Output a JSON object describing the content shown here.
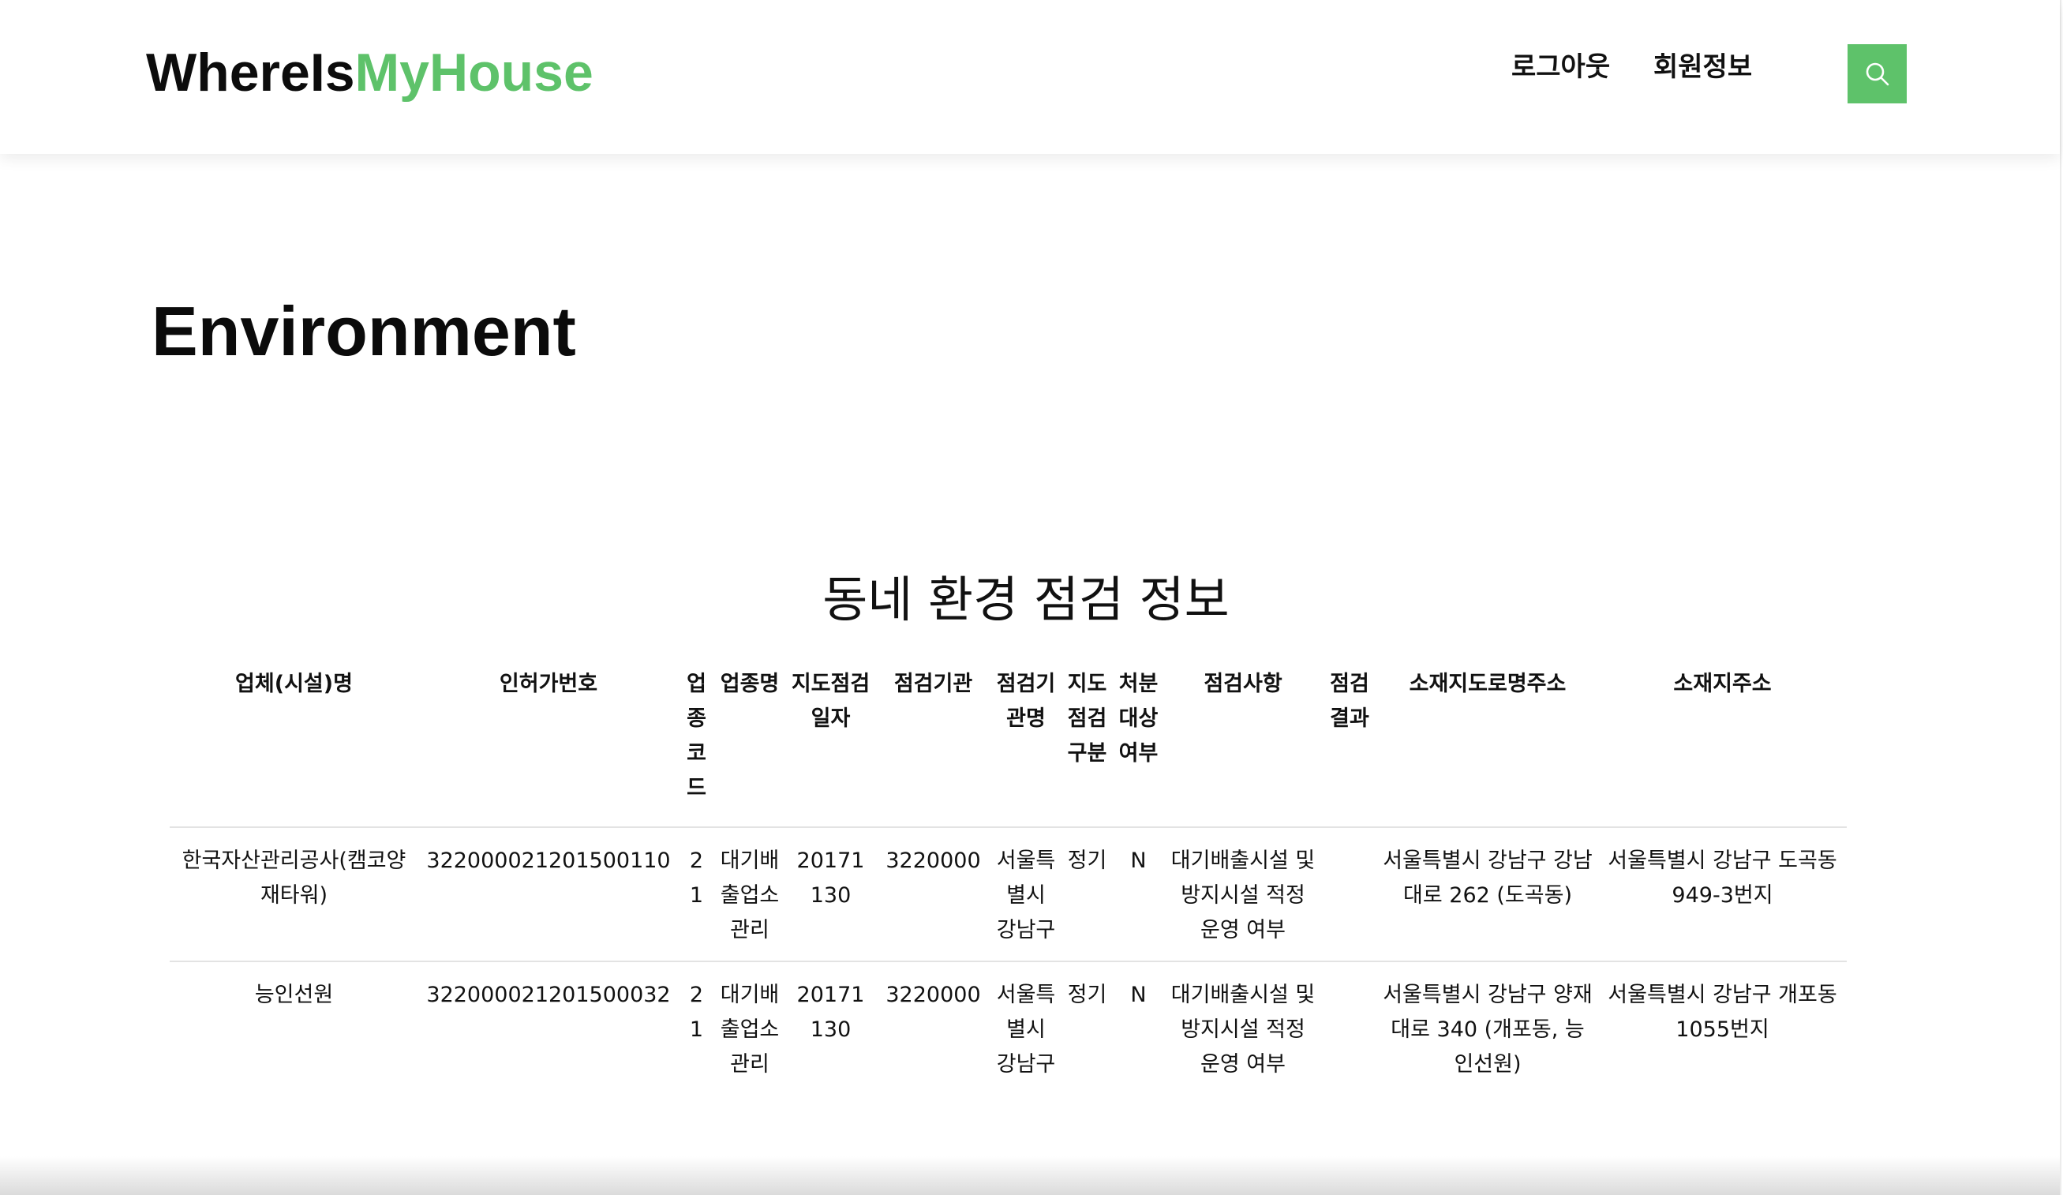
{
  "header": {
    "logo_part1": "WhereIs",
    "logo_part2": "MyHouse",
    "nav_logout": "로그아웃",
    "nav_member": "회원정보",
    "search_icon": "search-icon",
    "accent_color": "#5ec26a"
  },
  "page": {
    "title": "Environment"
  },
  "section": {
    "title": "동네 환경 점검 정보"
  },
  "table": {
    "headers": [
      "업체(시설)명",
      "인허가번호",
      "업종코드",
      "업종명",
      "지도점검일자",
      "점검기관",
      "점검기관명",
      "지도점검구분",
      "처분대상여부",
      "점검사항",
      "점검결과",
      "소재지도로명주소",
      "소재지주소"
    ],
    "rows": [
      [
        "한국자산관리공사(캠코양재타워)",
        "322000021201500110",
        "21",
        "대기배출업소관리",
        "20171130",
        "3220000",
        "서울특별시 강남구",
        "정기",
        "N",
        "대기배출시설 및 방지시설 적정 운영 여부",
        "",
        "서울특별시 강남구 강남대로 262 (도곡동)",
        "서울특별시 강남구 도곡동 949-3번지"
      ],
      [
        "능인선원",
        "322000021201500032",
        "21",
        "대기배출업소관리",
        "20171130",
        "3220000",
        "서울특별시 강남구",
        "정기",
        "N",
        "대기배출시설 및 방지시설 적정 운영 여부",
        "",
        "서울특별시 강남구 양재대로 340 (개포동, 능인선원)",
        "서울특별시 강남구 개포동 1055번지"
      ]
    ]
  }
}
